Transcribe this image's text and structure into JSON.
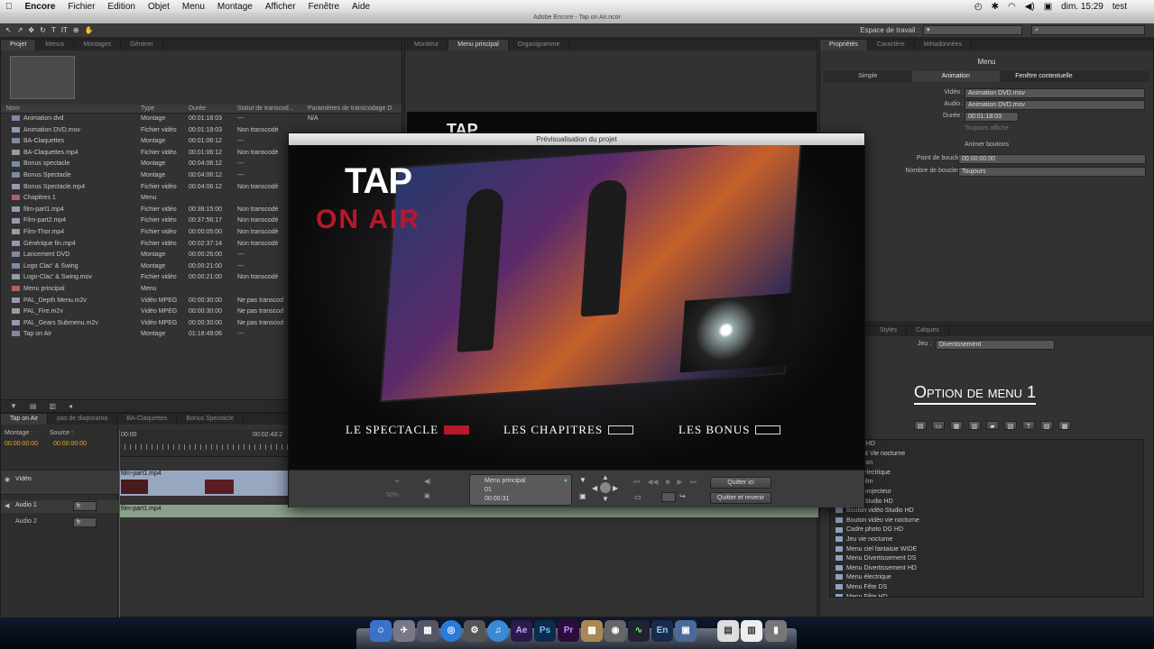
{
  "menubar": {
    "app": "Encore",
    "items": [
      "Fichier",
      "Edition",
      "Objet",
      "Menu",
      "Montage",
      "Afficher",
      "Fenêtre",
      "Aide"
    ],
    "clock": "dim. 15:29",
    "user": "test"
  },
  "window_title": "Adobe Encore - Tap on Air.ncor",
  "toolbar": {
    "workspace_label": "Espace de travail :"
  },
  "project_panel": {
    "tabs": [
      "Projet",
      "Menus",
      "Montages",
      "Générer"
    ],
    "columns": [
      "Nom",
      "Type",
      "Durée",
      "Statut de transcod...",
      "Paramètres de transcodage D"
    ],
    "rows": [
      {
        "name": "Animation dvd",
        "type": "Montage",
        "duration": "00:01:18:03",
        "status": "---",
        "params": "N/A",
        "icon": "timeline-icon"
      },
      {
        "name": "Animation DVD.mov",
        "type": "Fichier vidéo",
        "duration": "00:01:18:03",
        "status": "Non transcodé",
        "params": "",
        "icon": "video-file-icon"
      },
      {
        "name": "BA-Claquettes",
        "type": "Montage",
        "duration": "00:01:06:12",
        "status": "---",
        "params": "",
        "icon": "timeline-icon"
      },
      {
        "name": "BA-Claquettes.mp4",
        "type": "Fichier vidéo",
        "duration": "00:01:06:12",
        "status": "Non transcodé",
        "params": "",
        "icon": "video-file-icon"
      },
      {
        "name": "Bonus spectacle",
        "type": "Montage",
        "duration": "00:04:06:12",
        "status": "---",
        "params": "",
        "icon": "timeline-icon"
      },
      {
        "name": "Bonus Spectacle",
        "type": "Montage",
        "duration": "00:04:06:12",
        "status": "---",
        "params": "",
        "icon": "timeline-icon"
      },
      {
        "name": "Bonus Spectacle.mp4",
        "type": "Fichier vidéo",
        "duration": "00:04:06:12",
        "status": "Non transcodé",
        "params": "",
        "icon": "video-file-icon"
      },
      {
        "name": "Chapitres 1",
        "type": "Menu",
        "duration": "",
        "status": "",
        "params": "",
        "icon": "menu-icon"
      },
      {
        "name": "film-part1.mp4",
        "type": "Fichier vidéo",
        "duration": "00:38:15:00",
        "status": "Non transcodé",
        "params": "",
        "icon": "video-file-icon"
      },
      {
        "name": "Film-part2.mp4",
        "type": "Fichier vidéo",
        "duration": "00:37:56:17",
        "status": "Non transcodé",
        "params": "",
        "icon": "video-file-icon"
      },
      {
        "name": "Film-Thor.mp4",
        "type": "Fichier vidéo",
        "duration": "00:00:05:00",
        "status": "Non transcodé",
        "params": "",
        "icon": "video-file-icon"
      },
      {
        "name": "Générique fin.mp4",
        "type": "Fichier vidéo",
        "duration": "00:02:37:14",
        "status": "Non transcodé",
        "params": "",
        "icon": "video-file-icon"
      },
      {
        "name": "Lancement DVD",
        "type": "Montage",
        "duration": "00:00:26:00",
        "status": "---",
        "params": "",
        "icon": "timeline-icon"
      },
      {
        "name": "Logo Clac' & Swing",
        "type": "Montage",
        "duration": "00:00:21:00",
        "status": "---",
        "params": "",
        "icon": "timeline-icon"
      },
      {
        "name": "Logo-Clac' & Swing.mov",
        "type": "Fichier vidéo",
        "duration": "00:00:21:00",
        "status": "Non transcodé",
        "params": "",
        "icon": "video-file-icon"
      },
      {
        "name": "Menu principal",
        "type": "Menu",
        "duration": "",
        "status": "",
        "params": "",
        "icon": "menu-icon"
      },
      {
        "name": "PAL_Depth Menu.m2v",
        "type": "Vidéo MPEG",
        "duration": "00:00:30:00",
        "status": "Ne pas transcod",
        "params": "",
        "icon": "video-file-icon"
      },
      {
        "name": "PAL_Fire.m2v",
        "type": "Vidéo MPEG",
        "duration": "00:00:30:00",
        "status": "Ne pas transcod",
        "params": "",
        "icon": "video-file-icon"
      },
      {
        "name": "PAL_Gears Submenu.m2v",
        "type": "Vidéo MPEG",
        "duration": "00:00:30:00",
        "status": "Ne pas transcod",
        "params": "",
        "icon": "video-file-icon"
      },
      {
        "name": "Tap on Air",
        "type": "Montage",
        "duration": "01:18:49:06",
        "status": "---",
        "params": "",
        "icon": "timeline-icon"
      }
    ]
  },
  "monitor_panel": {
    "tabs": [
      "Moniteur",
      "Menu principal",
      "Organigramme"
    ],
    "behind_text": "TAP"
  },
  "properties_panel": {
    "tabs": [
      "Propriétés",
      "Caractère",
      "Métadonnées"
    ],
    "heading": "Menu",
    "subtabs": [
      "Simple",
      "Animation",
      "Fenêtre contextuelle"
    ],
    "fields": [
      {
        "label": "Vidéo :",
        "value": "Animation DVD.mov"
      },
      {
        "label": "Audio :",
        "value": "Animation DVD.mov"
      },
      {
        "label": "Durée :",
        "value": "00:01:18:03"
      }
    ],
    "always_shown": "Toujours affiché",
    "animate_buttons": "Animer boutons",
    "loop_point_label": "Point de boucle :",
    "loop_point_value": "00:00:00:00",
    "loop_count_label": "Nombre de boucles :",
    "loop_count_value": "Toujours"
  },
  "styles_panel": {
    "tabs": [
      "Styles",
      "Calques"
    ],
    "set_label": "Jeu :",
    "set_value": "Divertissement",
    "preview_text": "Option de menu 1",
    "items": [
      "Studio HD",
      "Survant Vie nocturne",
      "télévision",
      "vidéo électrique",
      "vidéo film",
      "vidéo projecteur",
      "Vidéo Studio HD",
      "Bouton vidéo Studio HD",
      "Bouton vidéo vie nocturne",
      "Cadre photo DG HD",
      "Jeu vie nocturne",
      "Menu ciel fantaisie WIDE",
      "Menu Divertissement DS",
      "Menu Divertissement HD",
      "Menu électrique",
      "Menu Fête DS",
      "Menu Fête HD"
    ]
  },
  "timeline_panel": {
    "tabs": [
      "Tap on Air",
      "pas de diaporama",
      "BA-Claquettes",
      "Bonus Spectacle"
    ],
    "montage_label": "Montage :",
    "source_label": "Source :",
    "montage_time": "00:00:00:00",
    "source_time": "00:00:00:00",
    "ruler_start": "00:00",
    "ruler_mid": "00:02:43:2",
    "tracks": [
      {
        "name": "Vidéo",
        "clip": "film-part1.mp4"
      },
      {
        "name": "Audio 1",
        "lang": "fr",
        "clip": ""
      },
      {
        "name": "Audio 2",
        "lang": "fr",
        "clip": "film-part1.mp4"
      }
    ]
  },
  "preview_dialog": {
    "title": "Prévisualisation du projet",
    "logo_line1": "TAP",
    "logo_line2": "ON AIR",
    "buttons": [
      "LE SPECTACLE",
      "LES CHAPITRES",
      "LES BONUS"
    ],
    "nav_title": "Menu principal",
    "nav_num": "01",
    "nav_time": "00:00:31",
    "zoom": "50%",
    "quit_here": "Quitter ici",
    "quit_return": "Quitter et revenir"
  },
  "colors": {
    "accent_red": "#b8182a",
    "panel_bg": "#323232",
    "timeline_clip": "#9aa7c0",
    "audio_clip": "#8aa08a"
  }
}
